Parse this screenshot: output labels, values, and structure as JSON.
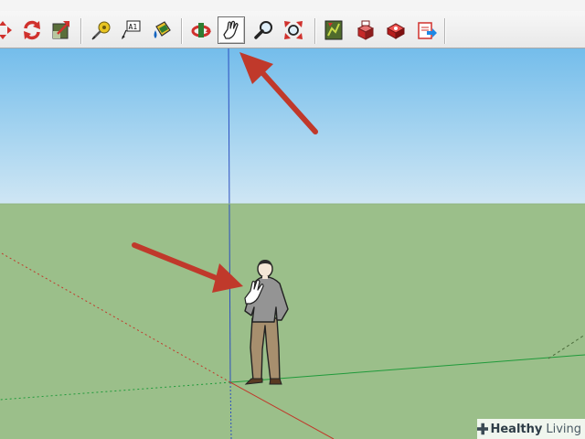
{
  "toolbar": {
    "tools": [
      {
        "name": "move-tool",
        "icon": "move-icon"
      },
      {
        "name": "rotate-tool",
        "icon": "rotate-icon"
      },
      {
        "name": "scale-tool",
        "icon": "scale-icon"
      },
      {
        "name": "tape-measure-tool",
        "icon": "tape-measure-icon"
      },
      {
        "name": "text-tool",
        "icon": "text-label-icon",
        "label": "A1"
      },
      {
        "name": "paint-bucket-tool",
        "icon": "paint-bucket-icon"
      },
      {
        "name": "orbit-tool",
        "icon": "orbit-icon"
      },
      {
        "name": "pan-tool",
        "icon": "hand-icon",
        "active": true
      },
      {
        "name": "zoom-tool",
        "icon": "magnifier-icon"
      },
      {
        "name": "zoom-extents-tool",
        "icon": "zoom-extents-icon"
      },
      {
        "name": "previous-view-tool",
        "icon": "map-icon"
      },
      {
        "name": "components-tool",
        "icon": "components-icon"
      },
      {
        "name": "materials-tool",
        "icon": "materials-icon"
      },
      {
        "name": "export-tool",
        "icon": "export-icon"
      }
    ]
  },
  "colors": {
    "sky_top": "#74bdeb",
    "ground": "#9bbf8a",
    "annotation_arrow": "#c0392b",
    "axis_blue": "#2b4fbf",
    "axis_green": "#1f9a3a",
    "axis_red": "#c0392b"
  },
  "watermark": {
    "brand_a": "Healthy",
    "brand_b": "Living",
    "icon": "medical-cross-icon"
  }
}
